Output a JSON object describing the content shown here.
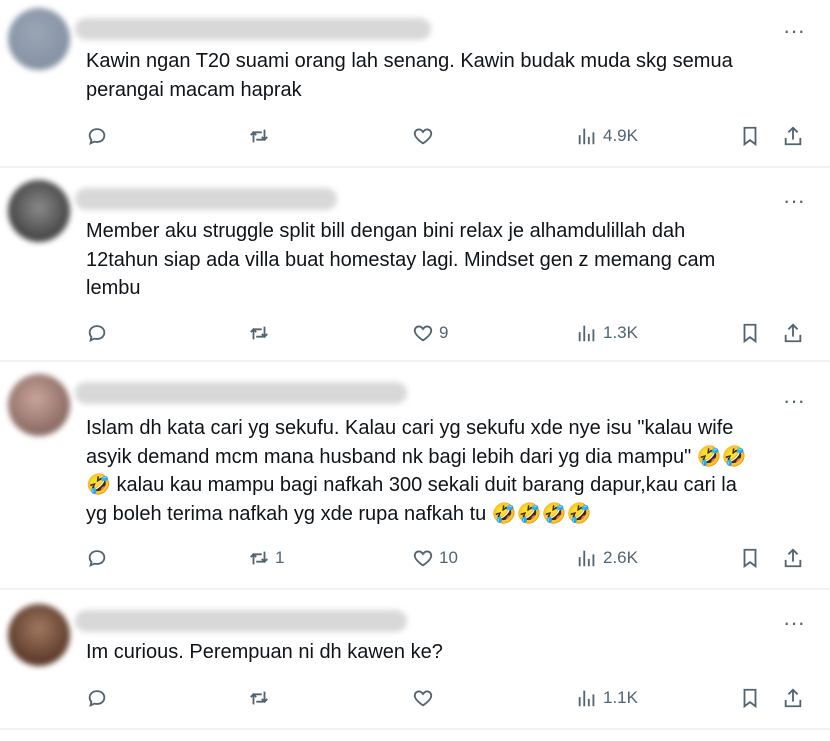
{
  "posts": [
    {
      "text": "Kawin ngan T20 suami orang lah senang. Kawin budak muda skg semua\nperangai macam haprak",
      "reply_count": "",
      "repost_count": "",
      "like_count": "",
      "view_count": "4.9K"
    },
    {
      "text": "Member aku struggle split bill dengan bini relax je alhamdulillah dah\n12tahun siap ada villa buat homestay lagi. Mindset gen z memang cam\nlembu",
      "reply_count": "",
      "repost_count": "",
      "like_count": "9",
      "view_count": "1.3K"
    },
    {
      "text": "Islam dh kata cari yg sekufu. Kalau cari yg sekufu xde nye isu \"kalau wife\nasyik demand mcm mana husband nk bagi lebih dari yg dia mampu\" 🤣🤣\n🤣 kalau kau mampu bagi nafkah 300 sekali duit barang dapur,kau cari la\nyg boleh terima nafkah yg xde rupa nafkah tu 🤣🤣🤣🤣",
      "reply_count": "",
      "repost_count": "1",
      "like_count": "10",
      "view_count": "2.6K"
    },
    {
      "text": "Im curious. Perempuan ni dh kawen ke?",
      "reply_count": "",
      "repost_count": "",
      "like_count": "",
      "view_count": "1.1K"
    }
  ],
  "icons": {
    "more": "more-icon",
    "reply": "reply-icon",
    "repost": "repost-icon",
    "like": "heart-icon",
    "views": "views-icon",
    "bookmark": "bookmark-icon",
    "share": "share-icon"
  },
  "more_glyph": "···",
  "colors": {
    "icon": "#536471",
    "text": "#0f1419",
    "divider": "#eff3f4"
  }
}
